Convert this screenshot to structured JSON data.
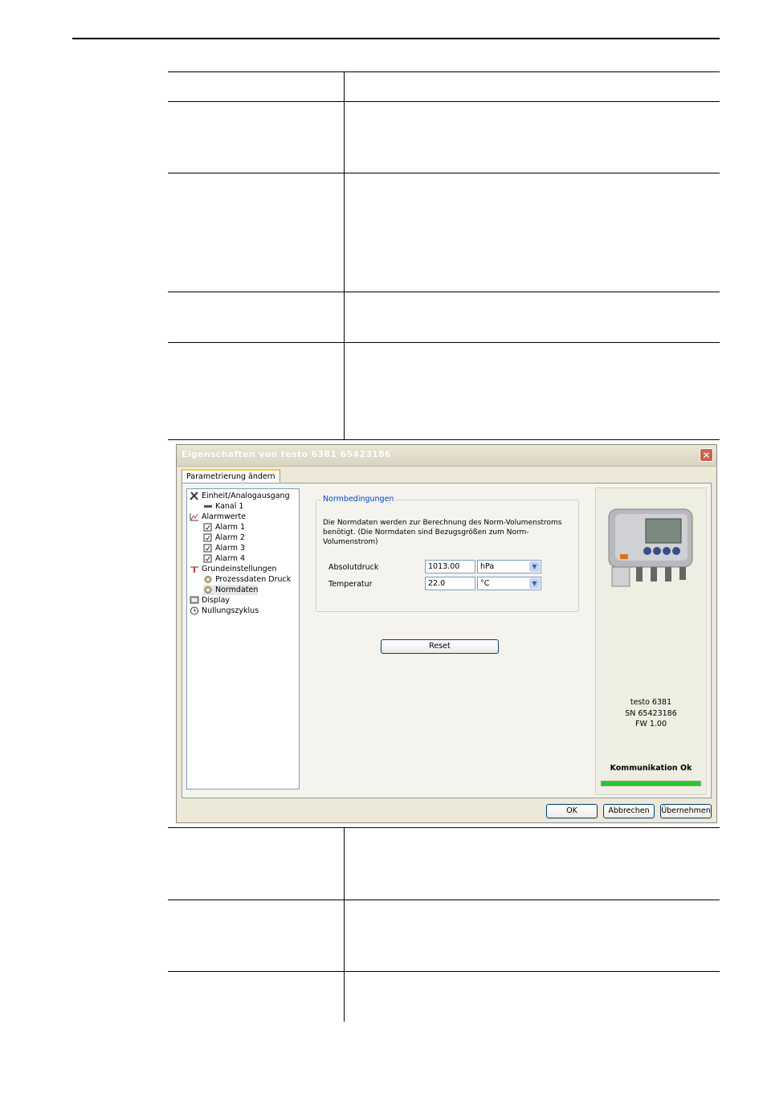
{
  "dialog": {
    "title": "Eigenschaften von testo 6381  65423186",
    "close_glyph": "✕",
    "tab_label": "Parametrierung ändern",
    "tree": [
      {
        "label": "Einheit/Analogausgang",
        "icon": "tools-icon"
      },
      {
        "label": "Kanal 1",
        "icon": "channel-icon"
      },
      {
        "label": "Alarmwerte",
        "icon": "alarm-chart-icon"
      },
      {
        "label": "Alarm 1",
        "icon": "alarm-item-icon"
      },
      {
        "label": "Alarm 2",
        "icon": "alarm-item-icon"
      },
      {
        "label": "Alarm 3",
        "icon": "alarm-item-icon"
      },
      {
        "label": "Alarm 4",
        "icon": "alarm-item-icon"
      },
      {
        "label": "Grundeinstellungen",
        "icon": "settings-icon"
      },
      {
        "label": "Prozessdaten Druck",
        "icon": "gear-icon"
      },
      {
        "label": "Normdaten",
        "icon": "gear-icon",
        "selected": true
      },
      {
        "label": "Display",
        "icon": "display-icon"
      },
      {
        "label": "Nullungszyklus",
        "icon": "clock-icon"
      }
    ],
    "group_title": "Normbedingungen",
    "description": "Die Normdaten werden zur Berechnung des Norm-Volumenstroms benötigt. (Die Normdaten sind Bezugsgrößen zum Norm-Volumenstrom)",
    "fields": {
      "pressure": {
        "label": "Absolutdruck",
        "value": "1013.00",
        "unit": "hPa"
      },
      "temperature": {
        "label": "Temperatur",
        "value": "22.0",
        "unit": "°C"
      }
    },
    "reset_label": "Reset",
    "device": {
      "model": "testo 6381",
      "serial": "SN 65423186",
      "firmware": "FW 1.00",
      "status": "Kommunikation Ok",
      "progress": 1.0,
      "progress_color": "#2cc52c"
    },
    "buttons": {
      "ok": "OK",
      "cancel": "Abbrechen",
      "apply": "Übernehmen"
    }
  }
}
